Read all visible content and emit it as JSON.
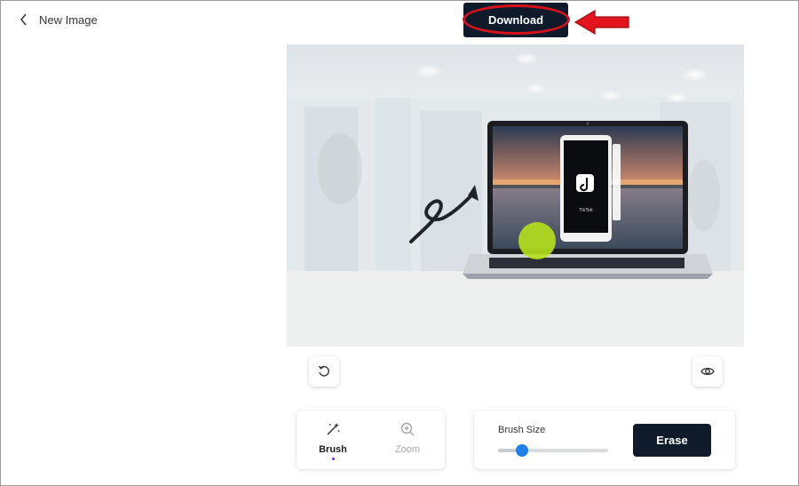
{
  "header": {
    "back_label": "New Image",
    "download_label": "Download"
  },
  "canvas": {
    "phone_app_caption": "TikTok"
  },
  "tools": {
    "brush_label": "Brush",
    "zoom_label": "Zoom"
  },
  "brush_panel": {
    "size_label": "Brush Size",
    "size_value": 0.22,
    "erase_label": "Erase"
  },
  "colors": {
    "dark_button": "#0f1b2b",
    "annotation_red": "#d8121b",
    "slider_thumb": "#1e80e8",
    "brush_marker": "#b6e01c",
    "active_dot": "#7b2fc4"
  },
  "icons": [
    "chevron-left-icon",
    "rotate-ccw-icon",
    "eye-icon",
    "magic-brush-icon",
    "zoom-in-icon",
    "tiktok-logo-icon"
  ]
}
